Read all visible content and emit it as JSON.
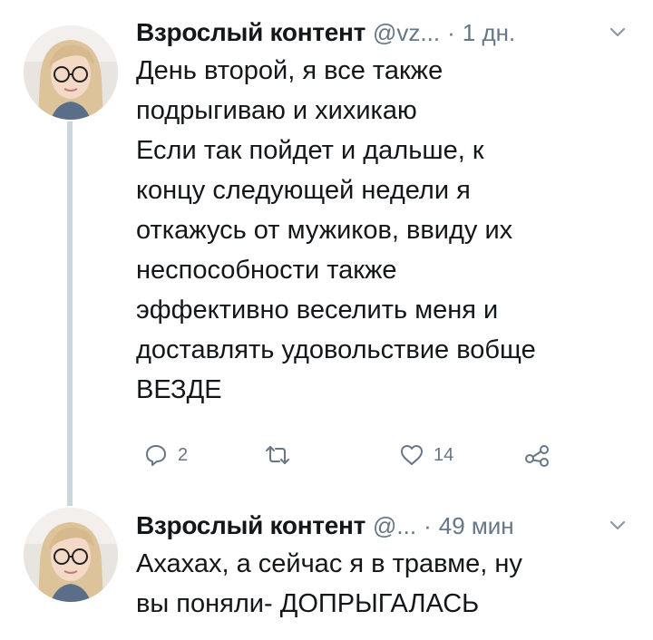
{
  "tweets": [
    {
      "display_name": "Взрослый контент",
      "handle": "@vz...",
      "separator": "·",
      "time": "1 дн.",
      "text_lines": [
        "День второй, я все также",
        "подрыгиваю и хихикаю",
        "Если так пойдет и дальше, к",
        "концу следующей недели я",
        "откажусь от мужиков, ввиду их",
        "неспособности также",
        "эффективно веселить меня и",
        "доставлять удовольствие вобще",
        "ВЕЗДЕ"
      ],
      "actions": {
        "reply_icon": "reply-icon",
        "reply_count": "2",
        "retweet_icon": "retweet-icon",
        "like_icon": "heart-icon",
        "like_count": "14",
        "share_icon": "share-icon"
      }
    },
    {
      "display_name": "Взрослый контент",
      "handle": "@...",
      "separator": "·",
      "time": "49 мин",
      "text_lines": [
        "Ахахах, а сейчас я в травме, ну",
        "вы поняли- ДОПРЫГАЛАСЬ"
      ]
    }
  ],
  "colors": {
    "text": "#14171a",
    "secondary": "#657786",
    "thread_line": "#ccd6dd"
  }
}
